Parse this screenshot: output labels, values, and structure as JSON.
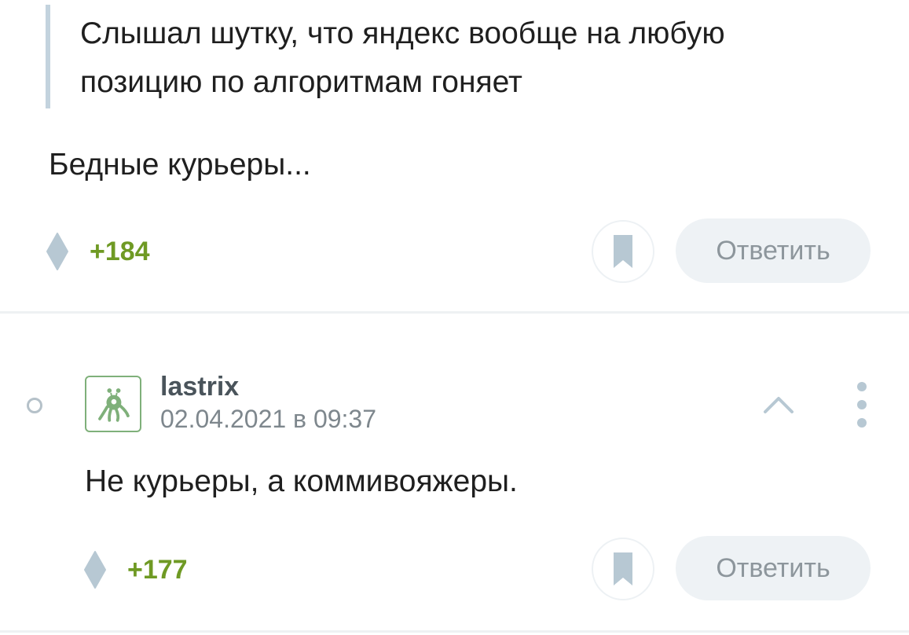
{
  "comments": [
    {
      "quote": "Слышал шутку, что яндекс вообще на любую позицию по алгоритмам гоняет",
      "text": "Бедные курьеры...",
      "score": "+184",
      "reply_label": "Ответить"
    },
    {
      "author": "lastrix",
      "timestamp": "02.04.2021 в 09:37",
      "text": "Не курьеры, а коммивояжеры.",
      "score": "+177",
      "reply_label": "Ответить"
    }
  ],
  "icons": {
    "vote": "diamond-vote-icon",
    "bookmark": "bookmark-icon",
    "collapse": "chevron-up-icon",
    "more": "vertical-dots-icon",
    "thread": "thread-dot-icon"
  },
  "colors": {
    "score_positive": "#6f9a24",
    "quote_border": "#c3d3de",
    "icon_muted": "#b7c8d3",
    "button_bg": "#eef2f5",
    "avatar_accent": "#7fb07a"
  }
}
